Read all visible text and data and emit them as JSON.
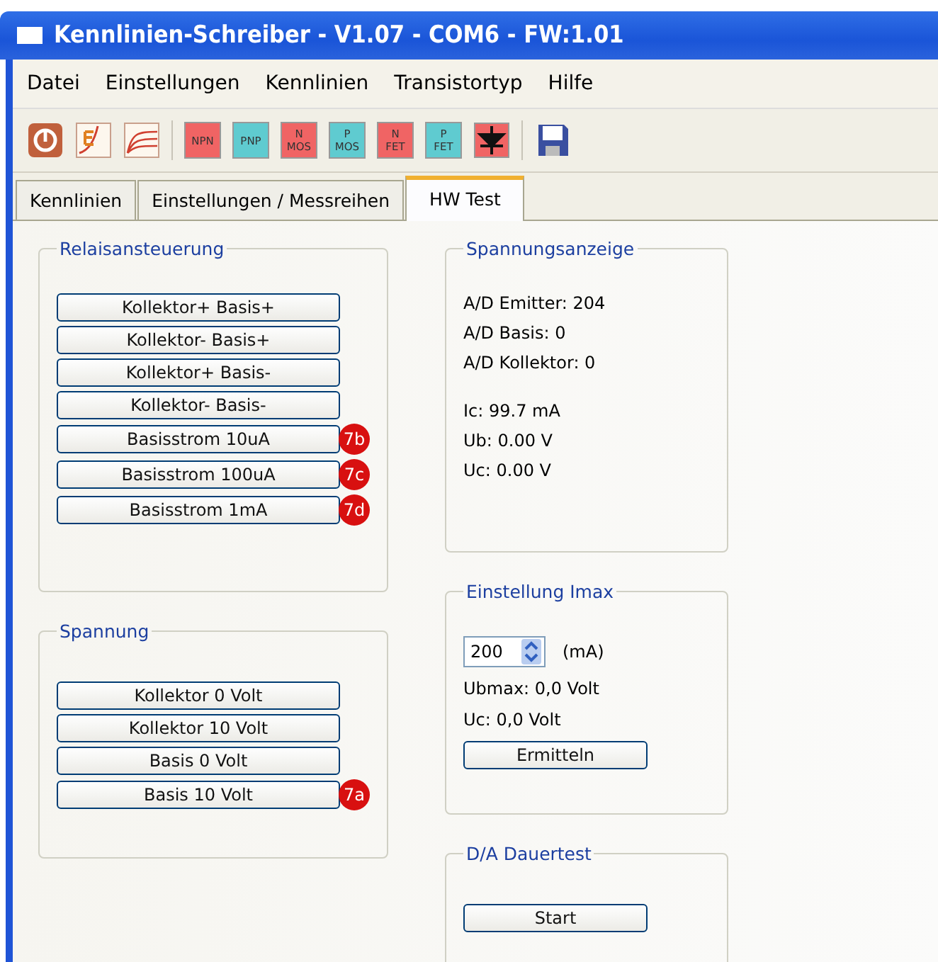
{
  "window": {
    "title": "Kennlinien-Schreiber - V1.07 - COM6 - FW:1.01"
  },
  "menu": [
    "Datei",
    "Einstellungen",
    "Kennlinien",
    "Transistortyp",
    "Hilfe"
  ],
  "toolbar": [
    {
      "kind": "power"
    },
    {
      "kind": "chart-e"
    },
    {
      "kind": "chart-curves"
    },
    {
      "kind": "separator"
    },
    {
      "kind": "type",
      "lines": [
        "NPN"
      ],
      "color": "#f06464"
    },
    {
      "kind": "type",
      "lines": [
        "PNP"
      ],
      "color": "#5fcbd0"
    },
    {
      "kind": "type",
      "lines": [
        "N",
        "MOS"
      ],
      "color": "#f06464"
    },
    {
      "kind": "type",
      "lines": [
        "P",
        "MOS"
      ],
      "color": "#5fcbd0"
    },
    {
      "kind": "type",
      "lines": [
        "N",
        "FET"
      ],
      "color": "#f06464"
    },
    {
      "kind": "type",
      "lines": [
        "P",
        "FET"
      ],
      "color": "#5fcbd0"
    },
    {
      "kind": "diode",
      "color": "#f06464"
    },
    {
      "kind": "separator"
    },
    {
      "kind": "save"
    }
  ],
  "tabs": [
    {
      "label": "Kennlinien",
      "selected": false
    },
    {
      "label": "Einstellungen / Messreihen",
      "selected": false
    },
    {
      "label": "HW Test",
      "selected": true
    }
  ],
  "relais": {
    "title": "Relaisansteuerung",
    "buttons": [
      {
        "label": "Kollektor+ Basis+"
      },
      {
        "label": "Kollektor- Basis+"
      },
      {
        "label": "Kollektor+ Basis-"
      },
      {
        "label": "Kollektor- Basis-"
      },
      {
        "label": "Basisstrom 10uA",
        "badge": "7b"
      },
      {
        "label": "Basisstrom 100uA",
        "badge": "7c"
      },
      {
        "label": "Basisstrom 1mA",
        "badge": "7d"
      }
    ]
  },
  "spannung": {
    "title": "Spannung",
    "buttons": [
      {
        "label": "Kollektor 0 Volt"
      },
      {
        "label": "Kollektor 10 Volt"
      },
      {
        "label": "Basis 0 Volt"
      },
      {
        "label": "Basis 10 Volt",
        "badge": "7a"
      }
    ]
  },
  "anzeige": {
    "title": "Spannungsanzeige",
    "groups": [
      [
        "A/D Emitter: 204",
        "A/D Basis: 0",
        "A/D Kollektor: 0"
      ],
      [
        "Ic: 99.7 mA",
        "Ub: 0.00 V",
        "Uc: 0.00 V"
      ]
    ]
  },
  "imax": {
    "title": "Einstellung Imax",
    "value": "200",
    "unit": "(mA)",
    "lines": [
      "Ubmax: 0,0 Volt",
      "Uc: 0,0 Volt"
    ],
    "button": "Ermitteln"
  },
  "dauertest": {
    "title": "D/A Dauertest",
    "button": "Start"
  }
}
